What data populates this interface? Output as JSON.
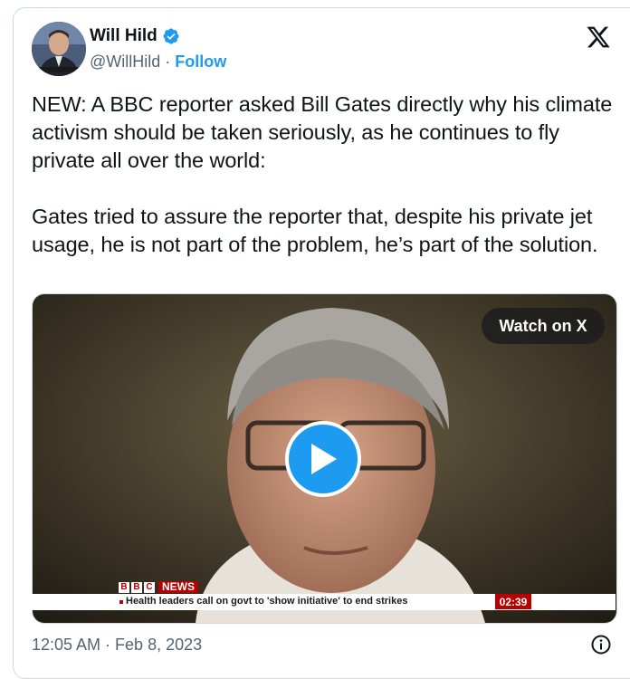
{
  "author": {
    "name": "Will Hild",
    "handle": "@WillHild",
    "separator": " · ",
    "follow_label": "Follow"
  },
  "tweet": {
    "paragraphs": [
      "NEW: A BBC reporter asked Bill Gates directly why his climate activism should be taken seriously, as he continues to fly private all over the world:",
      "Gates tried to assure the reporter that, despite his private jet usage, he is not part of the problem, he’s part of the solution."
    ],
    "timestamp": "12:05 AM · Feb 8, 2023"
  },
  "media": {
    "watch_label": "Watch on X",
    "bbc_letters": [
      "B",
      "B",
      "C"
    ],
    "news_label": "NEWS",
    "ticker": "Health leaders call on govt to 'show initiative' to end strikes",
    "clock": "02:39"
  },
  "colors": {
    "accent": "#1d9bf0",
    "bbc_red": "#b80000",
    "text": "#0f1419",
    "muted": "#536471"
  },
  "icons": {
    "verified": "verified-badge-icon",
    "x_logo": "x-logo-icon",
    "play": "play-icon",
    "info": "info-icon"
  }
}
